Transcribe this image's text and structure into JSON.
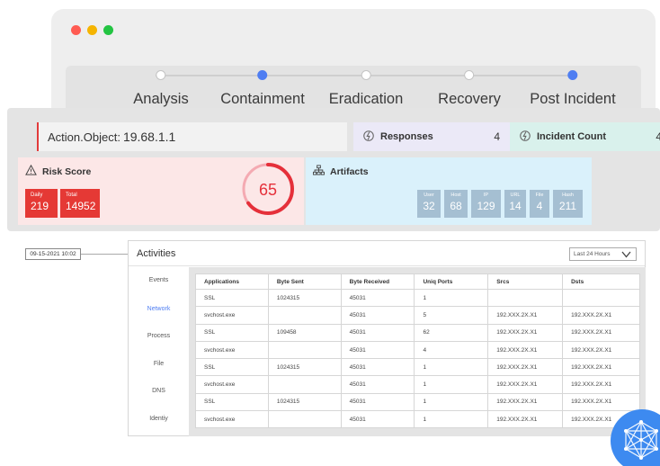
{
  "stages": [
    {
      "label": "Analysis",
      "state": "done"
    },
    {
      "label": "Containment",
      "state": "active"
    },
    {
      "label": "Eradication",
      "state": "pending"
    },
    {
      "label": "Recovery",
      "state": "pending"
    },
    {
      "label": "Post Incident",
      "state": "active"
    }
  ],
  "action": {
    "label": "Action.Object:",
    "value": "19.68.1.1"
  },
  "responses": {
    "label": "Responses",
    "count": "4",
    "icon": "refresh-icon"
  },
  "incident": {
    "label": "Incident Count",
    "count": "4",
    "icon": "refresh-icon"
  },
  "risk": {
    "title": "Risk Score",
    "icon": "warning-icon",
    "score": "65",
    "score_fraction": 0.65,
    "daily_label": "Daily",
    "daily_value": "219",
    "total_label": "Total",
    "total_value": "14952"
  },
  "artifacts": {
    "title": "Artifacts",
    "icon": "hierarchy-icon",
    "tiles": [
      {
        "label": "User",
        "value": "32"
      },
      {
        "label": "Host",
        "value": "68"
      },
      {
        "label": "IP",
        "value": "129"
      },
      {
        "label": "URL",
        "value": "14"
      },
      {
        "label": "File",
        "value": "4"
      },
      {
        "label": "Hash",
        "value": "211"
      }
    ]
  },
  "timestamp": "09-15-2021 10:02",
  "activities": {
    "title": "Activities",
    "range": "Last 24 Hours",
    "sidebar": [
      "Events",
      "Network",
      "Process",
      "File",
      "DNS",
      "Identiy"
    ],
    "selected": "Network",
    "columns": [
      "Applications",
      "Byte Sent",
      "Byte Received",
      "Uniq Ports",
      "Srcs",
      "Dsts"
    ],
    "rows": [
      [
        "SSL",
        "1024315",
        "45031",
        "1",
        "",
        ""
      ],
      [
        "svchost.exe",
        "",
        "45031",
        "5",
        "192.XXX.2X.X1",
        "192.XXX.2X.X1"
      ],
      [
        "SSL",
        "109458",
        "45031",
        "62",
        "192.XXX.2X.X1",
        "192.XXX.2X.X1"
      ],
      [
        "svchost.exe",
        "",
        "45031",
        "4",
        "192.XXX.2X.X1",
        "192.XXX.2X.X1"
      ],
      [
        "SSL",
        "1024315",
        "45031",
        "1",
        "192.XXX.2X.X1",
        "192.XXX.2X.X1"
      ],
      [
        "svchost.exe",
        "",
        "45031",
        "1",
        "192.XXX.2X.X1",
        "192.XXX.2X.X1"
      ],
      [
        "SSL",
        "1024315",
        "45031",
        "1",
        "192.XXX.2X.X1",
        "192.XXX.2X.X1"
      ],
      [
        "svchost.exe",
        "",
        "45031",
        "1",
        "192.XXX.2X.X1",
        "192.XXX.2X.X1"
      ]
    ]
  },
  "colors": {
    "accent": "#4f7ef2",
    "danger": "#e53935",
    "tile": "#a5bfd2"
  }
}
